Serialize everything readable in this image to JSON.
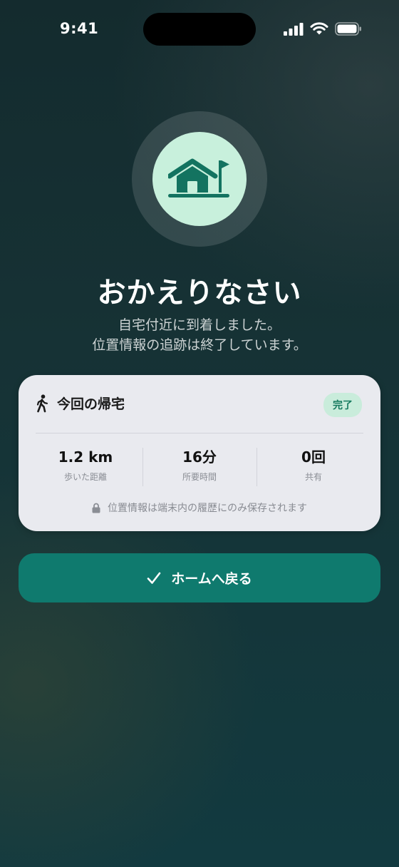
{
  "status_bar": {
    "time": "9:41",
    "icons": [
      "cellular-signal-icon",
      "wifi-icon",
      "battery-icon"
    ]
  },
  "hero": {
    "icon": "home-flag-icon",
    "title": "おかえりなさい",
    "subtitle_line1": "自宅付近に到着しました。",
    "subtitle_line2": "位置情報の追跡は終了しています。"
  },
  "trip_card": {
    "icon": "walking-person-icon",
    "title": "今回の帰宅",
    "badge": "完了",
    "stats": [
      {
        "value": "1.2 km",
        "label": "歩いた距離"
      },
      {
        "value": "16分",
        "label": "所要時間"
      },
      {
        "value": "0回",
        "label": "共有"
      }
    ],
    "privacy_icon": "lock-icon",
    "privacy_note": "位置情報は端末内の履歴にのみ保存されます"
  },
  "actions": {
    "home_icon": "checkmark-icon",
    "home_label": "ホームへ戻る"
  },
  "colors": {
    "accent": "#0f7a6e",
    "hero_circle": "#c8f0dc",
    "badge_bg": "#c9ecdb",
    "badge_text": "#157a5f",
    "card_bg": "#e9eaef"
  }
}
